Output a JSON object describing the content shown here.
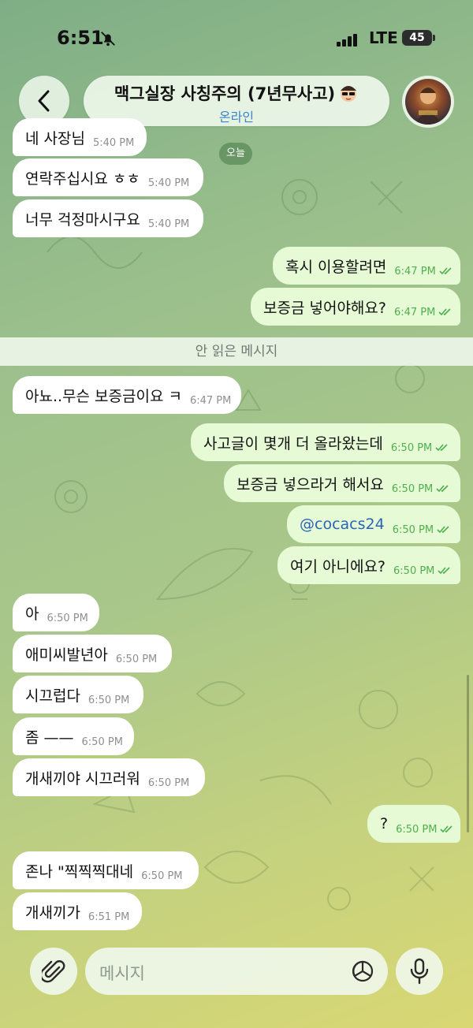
{
  "status_bar": {
    "time": "6:51",
    "network": "LTE",
    "battery": "45"
  },
  "header": {
    "title": "맥그실장 사칭주의 (7년무사고)",
    "subtitle": "온라인",
    "title_emoji": "cool-guy-emoji"
  },
  "day_badge": "오늘",
  "unread_divider": "안 읽은 메시지",
  "messages": [
    {
      "direction": "in",
      "text": "네 사장님",
      "time": "5:40 PM"
    },
    {
      "direction": "in",
      "text": "연락주십시요 ㅎㅎ",
      "time": "5:40 PM"
    },
    {
      "direction": "in",
      "text": "너무 걱정마시구요",
      "time": "5:40 PM"
    },
    {
      "direction": "out",
      "text": "혹시 이용할려면",
      "time": "6:47 PM",
      "read": true
    },
    {
      "direction": "out",
      "text": "보증금 넣어야해요?",
      "time": "6:47 PM",
      "read": true
    },
    {
      "direction": "in",
      "text": "아뇨..무슨 보증금이요 ㅋ",
      "time": "6:47 PM"
    },
    {
      "direction": "out",
      "text": "사고글이 몇개 더 올라왔는데",
      "time": "6:50 PM",
      "read": true
    },
    {
      "direction": "out",
      "text": "보증금 넣으라거 해서요",
      "time": "6:50 PM",
      "read": true
    },
    {
      "direction": "out",
      "text": "@cocacs24",
      "time": "6:50 PM",
      "read": true,
      "is_link": true
    },
    {
      "direction": "out",
      "text": "여기 아니에요?",
      "time": "6:50 PM",
      "read": true
    },
    {
      "direction": "in",
      "text": "아",
      "time": "6:50 PM"
    },
    {
      "direction": "in",
      "text": "애미씨발년아",
      "time": "6:50 PM"
    },
    {
      "direction": "in",
      "text": "시끄럽다",
      "time": "6:50 PM"
    },
    {
      "direction": "in",
      "text": "좀 ——",
      "time": "6:50 PM"
    },
    {
      "direction": "in",
      "text": "개새끼야 시끄러워",
      "time": "6:50 PM"
    },
    {
      "direction": "out",
      "text": "?",
      "time": "6:50 PM",
      "read": true
    },
    {
      "direction": "in",
      "text": "존나 \"찍찍찍대네",
      "time": "6:50 PM"
    },
    {
      "direction": "in",
      "text": "개새끼가",
      "time": "6:51 PM"
    }
  ],
  "composer": {
    "placeholder": "메시지"
  },
  "colors": {
    "incoming_bubble": "#ffffff",
    "outgoing_bubble": "#e6fbd5",
    "read_check": "#4fae4e",
    "link": "#2a64b8",
    "online": "#3a86c8"
  }
}
